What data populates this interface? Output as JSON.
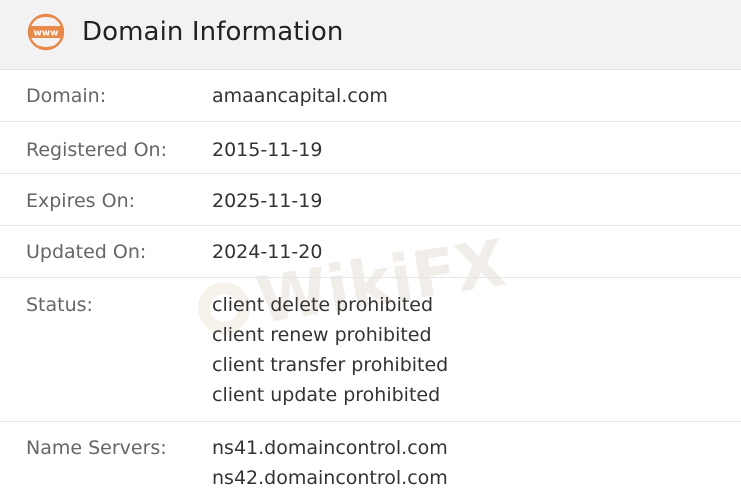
{
  "header": {
    "icon": "www-globe-icon",
    "icon_text": "www",
    "title": "Domain Information",
    "accent_color": "#e8894a"
  },
  "watermark": {
    "text": "WikiFX"
  },
  "rows": [
    {
      "label": "Domain:",
      "values": [
        "amaancapital.com"
      ]
    },
    {
      "label": "Registered On:",
      "values": [
        "2015-11-19"
      ]
    },
    {
      "label": "Expires On:",
      "values": [
        "2025-11-19"
      ]
    },
    {
      "label": "Updated On:",
      "values": [
        "2024-11-20"
      ]
    },
    {
      "label": "Status:",
      "values": [
        "client delete prohibited",
        "client renew prohibited",
        "client transfer prohibited",
        "client update prohibited"
      ]
    },
    {
      "label": "Name Servers:",
      "values": [
        "ns41.domaincontrol.com",
        "ns42.domaincontrol.com"
      ]
    }
  ]
}
